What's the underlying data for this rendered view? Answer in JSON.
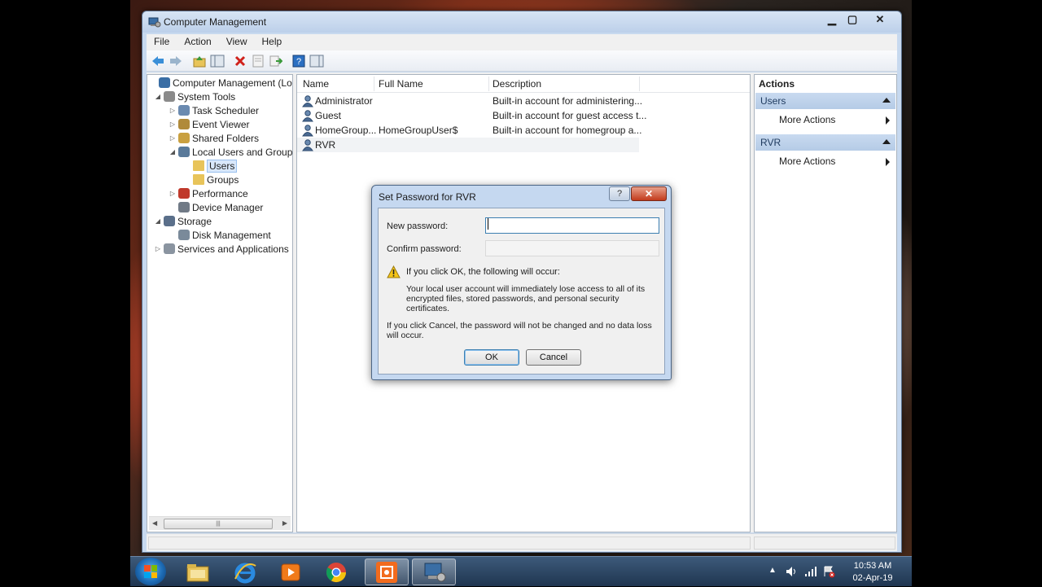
{
  "window": {
    "title": "Computer Management",
    "menu": [
      "File",
      "Action",
      "View",
      "Help"
    ]
  },
  "tree": {
    "items": [
      {
        "label": "Computer Management (Local",
        "level": 0,
        "arrow": "",
        "icon": "computer-management-icon"
      },
      {
        "label": "System Tools",
        "level": 1,
        "arrow": "◢",
        "icon": "tools-icon"
      },
      {
        "label": "Task Scheduler",
        "level": 2,
        "arrow": "▷",
        "icon": "clock-icon"
      },
      {
        "label": "Event Viewer",
        "level": 2,
        "arrow": "▷",
        "icon": "event-viewer-icon"
      },
      {
        "label": "Shared Folders",
        "level": 2,
        "arrow": "▷",
        "icon": "shared-folders-icon"
      },
      {
        "label": "Local Users and Groups",
        "level": 2,
        "arrow": "◢",
        "icon": "users-groups-icon"
      },
      {
        "label": "Users",
        "level": 3,
        "arrow": "",
        "icon": "folder-icon",
        "selected": true
      },
      {
        "label": "Groups",
        "level": 3,
        "arrow": "",
        "icon": "folder-icon"
      },
      {
        "label": "Performance",
        "level": 2,
        "arrow": "▷",
        "icon": "performance-icon"
      },
      {
        "label": "Device Manager",
        "level": 2,
        "arrow": "",
        "icon": "device-manager-icon"
      },
      {
        "label": "Storage",
        "level": 1,
        "arrow": "◢",
        "icon": "storage-icon"
      },
      {
        "label": "Disk Management",
        "level": 2,
        "arrow": "",
        "icon": "disk-icon"
      },
      {
        "label": "Services and Applications",
        "level": 1,
        "arrow": "▷",
        "icon": "services-icon"
      }
    ]
  },
  "list": {
    "columns": [
      "Name",
      "Full Name",
      "Description"
    ],
    "rows": [
      {
        "name": "Administrator",
        "full_name": "",
        "description": "Built-in account for administering..."
      },
      {
        "name": "Guest",
        "full_name": "",
        "description": "Built-in account for guest access t..."
      },
      {
        "name": "HomeGroup...",
        "full_name": "HomeGroupUser$",
        "description": "Built-in account for homegroup a..."
      },
      {
        "name": "RVR",
        "full_name": "",
        "description": "",
        "selected": true
      }
    ]
  },
  "actions": {
    "title": "Actions",
    "sections": [
      {
        "header": "Users",
        "item": "More Actions"
      },
      {
        "header": "RVR",
        "item": "More Actions"
      }
    ]
  },
  "dialog": {
    "title": "Set Password for RVR",
    "help_label": "?",
    "close_label": "✕",
    "new_password_label": "New password:",
    "new_password_value": "",
    "confirm_password_label": "Confirm password:",
    "confirm_password_value": "",
    "warning_heading": "If you click OK, the following will occur:",
    "warning_body": "Your local user account will immediately lose access to all of its encrypted files, stored passwords, and personal security certificates.",
    "cancel_note": "If you click Cancel, the password will not be changed and no data loss will occur.",
    "ok_label": "OK",
    "cancel_label": "Cancel"
  },
  "taskbar": {
    "apps": [
      "start-button",
      "file-explorer-icon",
      "internet-explorer-icon",
      "media-player-icon",
      "chrome-icon",
      "screen-recorder-icon",
      "computer-management-icon"
    ],
    "time": "10:53 AM",
    "date": "02-Apr-19"
  }
}
